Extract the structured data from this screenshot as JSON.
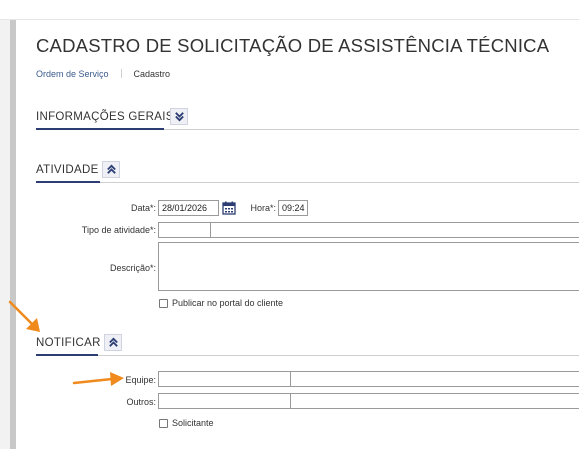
{
  "page": {
    "title": "CADASTRO DE SOLICITAÇÃO DE ASSISTÊNCIA TÉCNICA",
    "breadcrumb": {
      "parent": "Ordem de Serviço",
      "current": "Cadastro"
    }
  },
  "sections": {
    "general": {
      "title": "INFORMAÇÕES GERAIS",
      "state": "collapsed",
      "toggle_icon": "double-chevron-down-icon"
    },
    "activity": {
      "title": "ATIVIDADE",
      "state": "expanded",
      "toggle_icon": "double-chevron-up-icon"
    },
    "notify": {
      "title": "NOTIFICAR",
      "state": "expanded",
      "toggle_icon": "double-chevron-up-icon"
    }
  },
  "activity_form": {
    "date_label": "Data*:",
    "date_value": "28/01/2026",
    "time_label": "Hora*:",
    "time_value": "09:24",
    "type_label": "Tipo de atividade*:",
    "type_code": "",
    "type_description": "",
    "description_label": "Descrição*:",
    "description_value": "",
    "publish_label": "Publicar no portal do cliente",
    "publish_checked": false
  },
  "notify_form": {
    "team_label": "Equipe:",
    "team_code": "",
    "team_name": "",
    "others_label": "Outros:",
    "others_code": "",
    "others_name": "",
    "requester_label": "Solicitante",
    "requester_checked": false
  },
  "colors": {
    "accent": "#2c3d73",
    "link": "#3c5a8c",
    "annotation_arrow": "#f08a1c"
  },
  "icons": [
    "calendar-icon",
    "double-chevron-down-icon",
    "double-chevron-up-icon"
  ]
}
